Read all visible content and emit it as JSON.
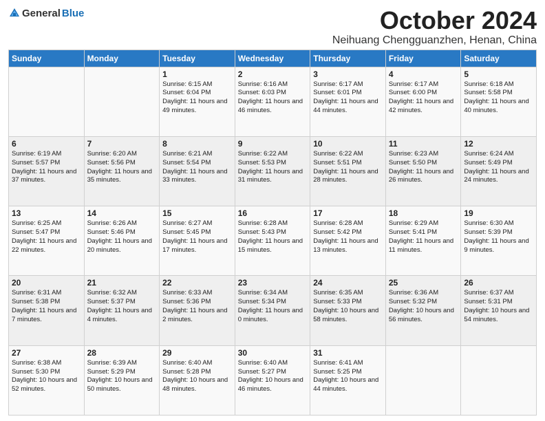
{
  "logo": {
    "general": "General",
    "blue": "Blue"
  },
  "header": {
    "month": "October 2024",
    "location": "Neihuang Chengguanzhen, Henan, China"
  },
  "days_of_week": [
    "Sunday",
    "Monday",
    "Tuesday",
    "Wednesday",
    "Thursday",
    "Friday",
    "Saturday"
  ],
  "weeks": [
    [
      {
        "day": "",
        "info": ""
      },
      {
        "day": "",
        "info": ""
      },
      {
        "day": "1",
        "info": "Sunrise: 6:15 AM\nSunset: 6:04 PM\nDaylight: 11 hours and 49 minutes."
      },
      {
        "day": "2",
        "info": "Sunrise: 6:16 AM\nSunset: 6:03 PM\nDaylight: 11 hours and 46 minutes."
      },
      {
        "day": "3",
        "info": "Sunrise: 6:17 AM\nSunset: 6:01 PM\nDaylight: 11 hours and 44 minutes."
      },
      {
        "day": "4",
        "info": "Sunrise: 6:17 AM\nSunset: 6:00 PM\nDaylight: 11 hours and 42 minutes."
      },
      {
        "day": "5",
        "info": "Sunrise: 6:18 AM\nSunset: 5:58 PM\nDaylight: 11 hours and 40 minutes."
      }
    ],
    [
      {
        "day": "6",
        "info": "Sunrise: 6:19 AM\nSunset: 5:57 PM\nDaylight: 11 hours and 37 minutes."
      },
      {
        "day": "7",
        "info": "Sunrise: 6:20 AM\nSunset: 5:56 PM\nDaylight: 11 hours and 35 minutes."
      },
      {
        "day": "8",
        "info": "Sunrise: 6:21 AM\nSunset: 5:54 PM\nDaylight: 11 hours and 33 minutes."
      },
      {
        "day": "9",
        "info": "Sunrise: 6:22 AM\nSunset: 5:53 PM\nDaylight: 11 hours and 31 minutes."
      },
      {
        "day": "10",
        "info": "Sunrise: 6:22 AM\nSunset: 5:51 PM\nDaylight: 11 hours and 28 minutes."
      },
      {
        "day": "11",
        "info": "Sunrise: 6:23 AM\nSunset: 5:50 PM\nDaylight: 11 hours and 26 minutes."
      },
      {
        "day": "12",
        "info": "Sunrise: 6:24 AM\nSunset: 5:49 PM\nDaylight: 11 hours and 24 minutes."
      }
    ],
    [
      {
        "day": "13",
        "info": "Sunrise: 6:25 AM\nSunset: 5:47 PM\nDaylight: 11 hours and 22 minutes."
      },
      {
        "day": "14",
        "info": "Sunrise: 6:26 AM\nSunset: 5:46 PM\nDaylight: 11 hours and 20 minutes."
      },
      {
        "day": "15",
        "info": "Sunrise: 6:27 AM\nSunset: 5:45 PM\nDaylight: 11 hours and 17 minutes."
      },
      {
        "day": "16",
        "info": "Sunrise: 6:28 AM\nSunset: 5:43 PM\nDaylight: 11 hours and 15 minutes."
      },
      {
        "day": "17",
        "info": "Sunrise: 6:28 AM\nSunset: 5:42 PM\nDaylight: 11 hours and 13 minutes."
      },
      {
        "day": "18",
        "info": "Sunrise: 6:29 AM\nSunset: 5:41 PM\nDaylight: 11 hours and 11 minutes."
      },
      {
        "day": "19",
        "info": "Sunrise: 6:30 AM\nSunset: 5:39 PM\nDaylight: 11 hours and 9 minutes."
      }
    ],
    [
      {
        "day": "20",
        "info": "Sunrise: 6:31 AM\nSunset: 5:38 PM\nDaylight: 11 hours and 7 minutes."
      },
      {
        "day": "21",
        "info": "Sunrise: 6:32 AM\nSunset: 5:37 PM\nDaylight: 11 hours and 4 minutes."
      },
      {
        "day": "22",
        "info": "Sunrise: 6:33 AM\nSunset: 5:36 PM\nDaylight: 11 hours and 2 minutes."
      },
      {
        "day": "23",
        "info": "Sunrise: 6:34 AM\nSunset: 5:34 PM\nDaylight: 11 hours and 0 minutes."
      },
      {
        "day": "24",
        "info": "Sunrise: 6:35 AM\nSunset: 5:33 PM\nDaylight: 10 hours and 58 minutes."
      },
      {
        "day": "25",
        "info": "Sunrise: 6:36 AM\nSunset: 5:32 PM\nDaylight: 10 hours and 56 minutes."
      },
      {
        "day": "26",
        "info": "Sunrise: 6:37 AM\nSunset: 5:31 PM\nDaylight: 10 hours and 54 minutes."
      }
    ],
    [
      {
        "day": "27",
        "info": "Sunrise: 6:38 AM\nSunset: 5:30 PM\nDaylight: 10 hours and 52 minutes."
      },
      {
        "day": "28",
        "info": "Sunrise: 6:39 AM\nSunset: 5:29 PM\nDaylight: 10 hours and 50 minutes."
      },
      {
        "day": "29",
        "info": "Sunrise: 6:40 AM\nSunset: 5:28 PM\nDaylight: 10 hours and 48 minutes."
      },
      {
        "day": "30",
        "info": "Sunrise: 6:40 AM\nSunset: 5:27 PM\nDaylight: 10 hours and 46 minutes."
      },
      {
        "day": "31",
        "info": "Sunrise: 6:41 AM\nSunset: 5:25 PM\nDaylight: 10 hours and 44 minutes."
      },
      {
        "day": "",
        "info": ""
      },
      {
        "day": "",
        "info": ""
      }
    ]
  ]
}
